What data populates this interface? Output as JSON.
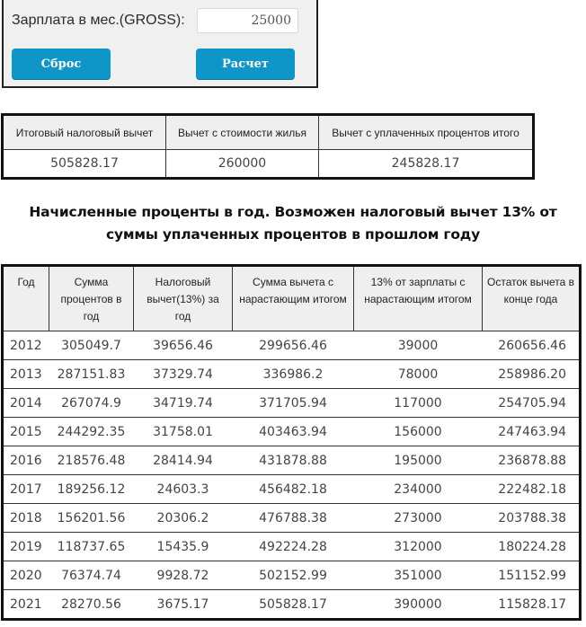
{
  "calculator": {
    "salary_label": "Зарплата в мес.(GROSS):",
    "salary_value": "25000",
    "reset_label": "Сброс",
    "calc_label": "Расчет",
    "accent_color": "#0e96c9"
  },
  "summary": {
    "headers": [
      "Итоговый налоговый вычет",
      "Вычет с стоимости жилья",
      "Вычет с уплаченных процентов итого"
    ],
    "values": [
      "505828.17",
      "260000",
      "245828.17"
    ]
  },
  "section_title": {
    "line1": "Начисленные проценты в год. Возможен налоговый вычет 13% от",
    "line2": "суммы уплаченных процентов в прошлом году"
  },
  "schedule": {
    "headers": [
      "Год",
      "Сумма процентов в год",
      "Налоговый вычет(13%) за год",
      "Сумма вычета с нарастающим итогом",
      "13% от зарплаты с нарастающим итогом",
      "Остаток вычета в конце года"
    ],
    "rows": [
      [
        "2012",
        "305049.7",
        "39656.46",
        "299656.46",
        "39000",
        "260656.46"
      ],
      [
        "2013",
        "287151.83",
        "37329.74",
        "336986.2",
        "78000",
        "258986.20"
      ],
      [
        "2014",
        "267074.9",
        "34719.74",
        "371705.94",
        "117000",
        "254705.94"
      ],
      [
        "2015",
        "244292.35",
        "31758.01",
        "403463.94",
        "156000",
        "247463.94"
      ],
      [
        "2016",
        "218576.48",
        "28414.94",
        "431878.88",
        "195000",
        "236878.88"
      ],
      [
        "2017",
        "189256.12",
        "24603.3",
        "456482.18",
        "234000",
        "222482.18"
      ],
      [
        "2018",
        "156201.56",
        "20306.2",
        "476788.38",
        "273000",
        "203788.38"
      ],
      [
        "2019",
        "118737.65",
        "15435.9",
        "492224.28",
        "312000",
        "180224.28"
      ],
      [
        "2020",
        "76374.74",
        "9928.72",
        "502152.99",
        "351000",
        "151152.99"
      ],
      [
        "2021",
        "28270.56",
        "3675.17",
        "505828.17",
        "390000",
        "115828.17"
      ]
    ]
  }
}
